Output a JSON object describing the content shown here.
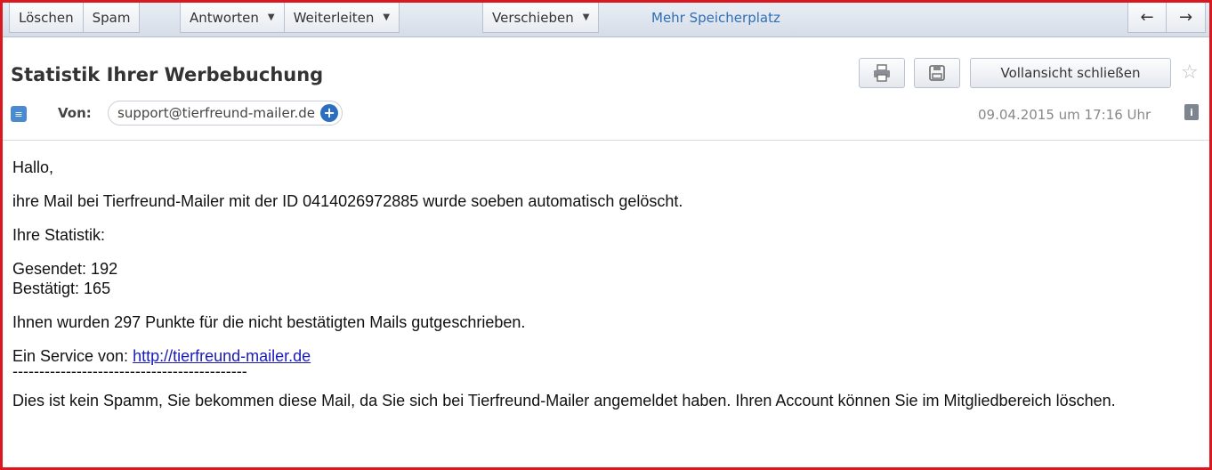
{
  "toolbar": {
    "delete": "Löschen",
    "spam": "Spam",
    "reply": "Antworten",
    "forward": "Weiterleiten",
    "move": "Verschieben",
    "more_storage": "Mehr Speicherplatz",
    "caret_icon": "caret-down-icon",
    "prev_icon": "arrow-left-icon",
    "next_icon": "arrow-right-icon"
  },
  "header": {
    "subject": "Statistik Ihrer Werbebuchung",
    "close_full_view": "Vollansicht schließen",
    "from_label": "Von:",
    "sender": "support@tierfreund-mailer.de",
    "date": "09.04.2015 um 17:16 Uhr"
  },
  "body": {
    "greeting": "Hallo,",
    "line1": "ihre Mail bei Tierfreund-Mailer mit der ID 0414026972885 wurde soeben automatisch gelöscht.",
    "stats_heading": "Ihre Statistik:",
    "sent": "Gesendet: 192",
    "confirmed": "Bestätigt: 165",
    "points": "Ihnen wurden 297 Punkte für die nicht bestätigten Mails gutgeschrieben.",
    "service_prefix": "Ein Service von: ",
    "service_link": "http://tierfreund-mailer.de",
    "separator": "--------------------------------------------",
    "footer": "Dies ist kein Spamm, Sie bekommen diese Mail, da Sie sich bei Tierfreund-Mailer angemeldet haben. Ihren Account können Sie im Mitgliedbereich löschen."
  },
  "colors": {
    "frame": "#d9191f",
    "accent": "#2d6fbf",
    "link": "#1a1ab8"
  }
}
